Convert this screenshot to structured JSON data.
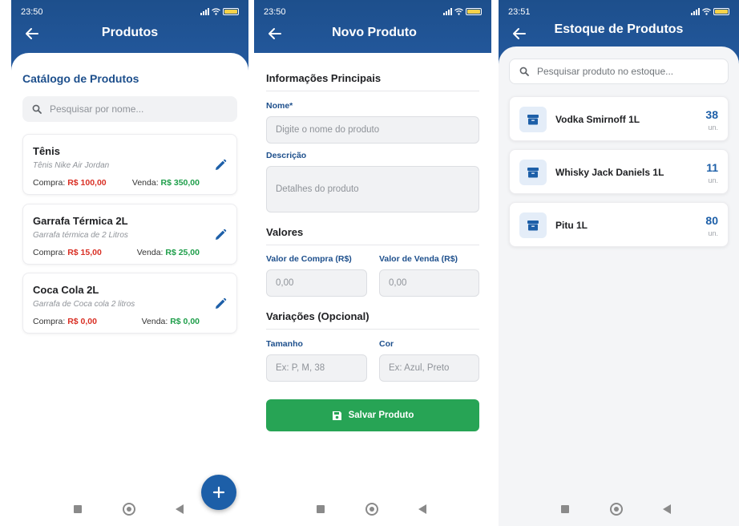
{
  "screens": {
    "products": {
      "status_time": "23:50",
      "title": "Produtos",
      "section_heading": "Catálogo de Produtos",
      "search_placeholder": "Pesquisar por nome...",
      "buy_label": "Compra:",
      "sell_label": "Venda:",
      "items": [
        {
          "name": "Tênis",
          "description": "Tênis Nike Air Jordan",
          "buy": "R$ 100,00",
          "sell": "R$ 350,00"
        },
        {
          "name": "Garrafa Térmica 2L",
          "description": "Garrafa térmica de 2 Litros",
          "buy": "R$ 15,00",
          "sell": "R$ 25,00"
        },
        {
          "name": "Coca Cola 2L",
          "description": "Garrafa de Coca cola 2 litros",
          "buy": "R$ 0,00",
          "sell": "R$ 0,00"
        }
      ],
      "fab_icon": "plus-icon"
    },
    "new_product": {
      "status_time": "23:50",
      "title": "Novo Produto",
      "section_main": "Informações Principais",
      "name_label": "Nome*",
      "name_placeholder": "Digite o nome do produto",
      "description_label": "Descrição",
      "description_placeholder": "Detalhes do produto",
      "section_values": "Valores",
      "buy_label": "Valor de Compra (R$)",
      "buy_placeholder": "0,00",
      "sell_label": "Valor de Venda (R$)",
      "sell_placeholder": "0,00",
      "section_variations": "Variações (Opcional)",
      "size_label": "Tamanho",
      "size_placeholder": "Ex: P, M, 38",
      "color_label": "Cor",
      "color_placeholder": "Ex: Azul, Preto",
      "save_label": "Salvar Produto"
    },
    "stock": {
      "status_time": "23:51",
      "title": "Estoque de Produtos",
      "search_placeholder": "Pesquisar produto no estoque...",
      "items": [
        {
          "name": "Vodka Smirnoff 1L",
          "qty": "38",
          "unit": "un."
        },
        {
          "name": "Whisky Jack Daniels 1L",
          "qty": "11",
          "unit": "un."
        },
        {
          "name": "Pitu 1L",
          "qty": "80",
          "unit": "un."
        }
      ]
    }
  },
  "colors": {
    "header": "#1d4f8c",
    "accent": "#1d5fa8",
    "buy": "#d93025",
    "sell": "#1e9e4a",
    "save_button": "#27a455"
  }
}
